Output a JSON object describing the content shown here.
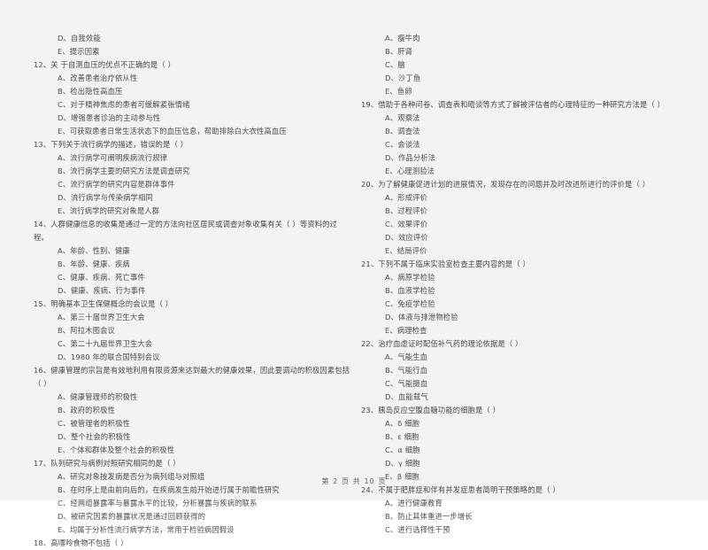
{
  "document": {
    "type": "scanned-exam-paper",
    "footer": "第 2 页 共 10 页"
  },
  "left_column": {
    "orphan_options": [
      "D、自我效能",
      "E、提示因素"
    ],
    "questions": [
      {
        "stem": "12、关 于自测血压的优点不正确的是（    ）",
        "options": [
          "A、改善患者治疗依从性",
          "B、检出隐性高血压",
          "C、对于精神焦虑的患者可缓解紧张情绪",
          "D、增强患者诊治的主动参与性",
          "E、可获取患者日常生活状态下的血压信息，帮助排除白大衣性高血压"
        ]
      },
      {
        "stem": "13、下列关于流行病学的描述，错误的是（    ）",
        "options": [
          "A、流行病学可阐明疾病流行规律",
          "B、流行病学主要的研究方法是调查研究",
          "C、流行病学的研究内容是群体事件",
          "D、流行病学与传染病学相同",
          "E、流行病学的研究对象是人群"
        ]
      },
      {
        "stem": "14、人群健康信息的收集是通过一定的方法向社区居民或调查对象收集有关（      ）等资料的过程。",
        "options": [
          "A、年龄、性别、健康",
          "B、年龄、健康、疾病",
          "C、健康、疾病、死亡事件",
          "D、健康、疾病、行为事件"
        ]
      },
      {
        "stem": "15、明确基本卫生保健概念的会议是（    ）",
        "options": [
          "A、第三十届世界卫生大会",
          "B、阿拉木图会议",
          "C、第二十九届世界卫生大会",
          "D、1980 年的联合国特别会议"
        ]
      },
      {
        "stem": "16、健康管理的宗旨是有效地利用有限资源来达到最大的健康效果，因此要调动的积极因素包括（    ）",
        "options": [
          "A、健康管理师的积极性",
          "B、政府的积极性",
          "C、被管理者的积极性",
          "D、整个社会的积极性",
          "E、个体和群体及整个社会的积极性"
        ]
      },
      {
        "stem": "17、队列研究与病例对照研究相同的是（    ）",
        "options": [
          "A、研究对象按发病是否分为病列组与对照组",
          "B、在时序上是由前向后的，在疾病发生前开始进行属于前瞻性研究",
          "C、经两组暴露率与暴露水平的比较，分析暴露与疾病的联系",
          "D、被研究因素的暴露状况是通过回顾获得的",
          "E、均属于分析性流行病学方法，常用于检验病因假设"
        ]
      },
      {
        "stem": "18、高嘌呤食物不包括（    ）",
        "options": []
      }
    ]
  },
  "right_column": {
    "orphan_options": [
      "A、瘦牛肉",
      "B、肝肾",
      "C、脑",
      "D、沙丁鱼",
      "E、鱼卵"
    ],
    "questions": [
      {
        "stem": "19、借助于各种问卷、调查表和晤谈等方式了解被评估者的心理特征的一种研究方法是（    ）",
        "options": [
          "A、观察法",
          "B、调查法",
          "C、会谈法",
          "D、作品分析法",
          "E、心理测验法"
        ]
      },
      {
        "stem": "20、为了解健康促进计划的进展情况，发现存在的问题并及时改进所进行的评价是（    ）",
        "options": [
          "A、形成评价",
          "B、过程评价",
          "C、效果评价",
          "D、效应评价",
          "E、结局评价"
        ]
      },
      {
        "stem": "21、下列不属于临床实验室检查主要内容的是（    ）",
        "options": [
          "A、病原学检验",
          "B、血液学检验",
          "C、免疫学检验",
          "D、体液与排泄物检验",
          "E、病理检查"
        ]
      },
      {
        "stem": "22、治疗血虚证时配伍补气药的理论依据是（    ）",
        "options": [
          "A、气能生血",
          "B、气能行血",
          "C、气能摄血",
          "D、血能载气"
        ]
      },
      {
        "stem": "23、胰岛反应空腹血糖功能的细胞是（    ）",
        "options": [
          "A、δ 细胞",
          "B、ε 细胞",
          "C、α 细胞",
          "D、γ 细胞",
          "E、β 细胞"
        ]
      },
      {
        "stem": "24、不属于肥胖症和伴有并发症患者简明干预策略的是（    ）",
        "options": [
          "A、进行健康教育",
          "B、防止其体重进一步增长",
          "C、进行选择性干预"
        ]
      }
    ]
  }
}
